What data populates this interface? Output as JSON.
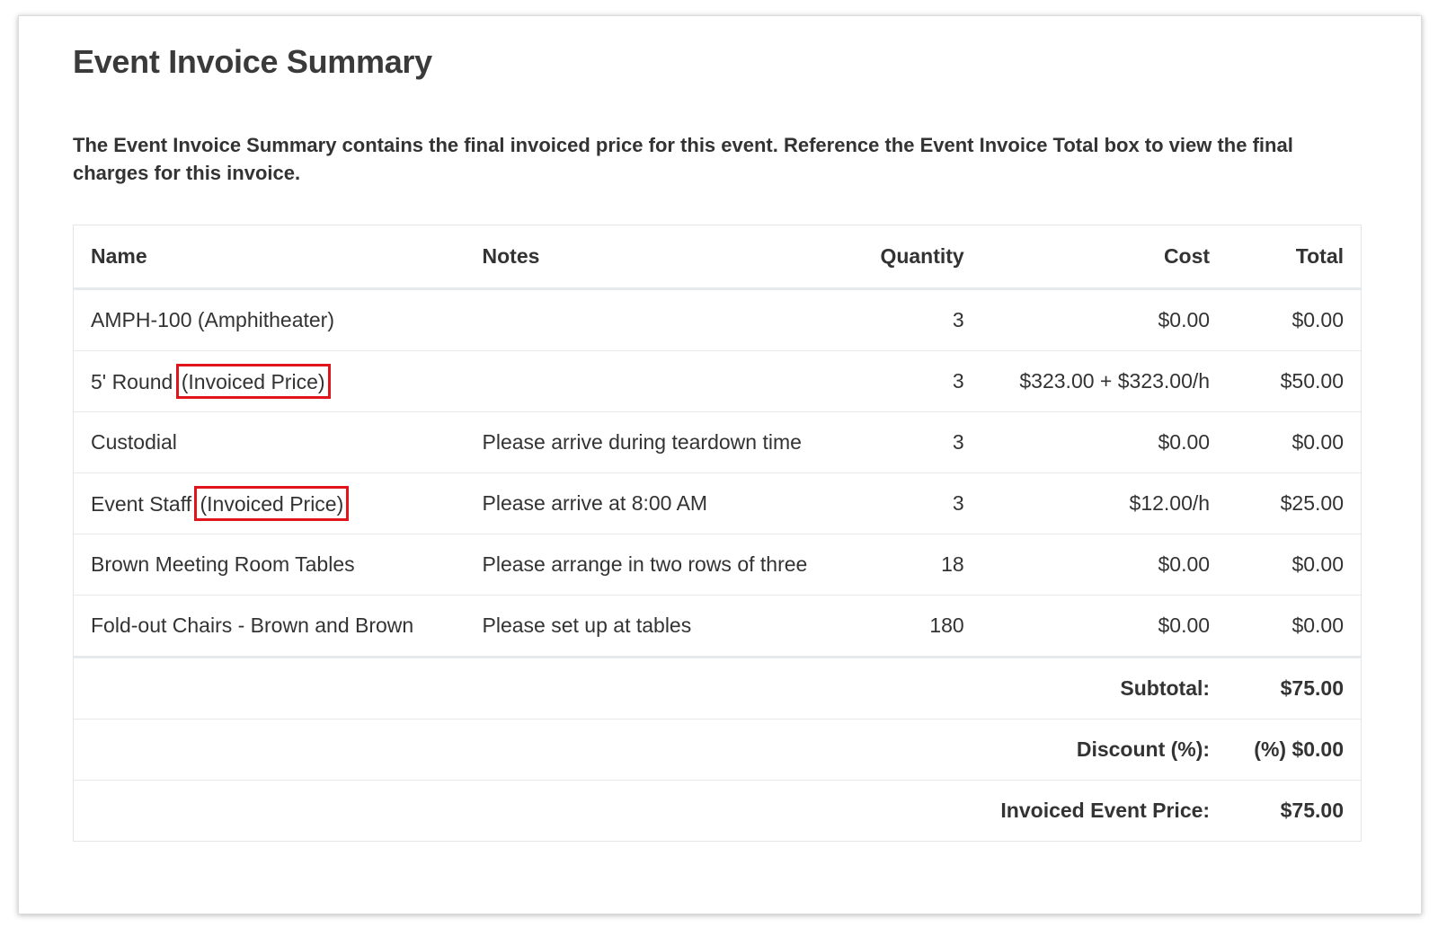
{
  "page": {
    "title": "Event Invoice Summary",
    "description": "The Event Invoice Summary contains the final invoiced price for this event. Reference the Event Invoice Total box to view the final charges for this invoice."
  },
  "table": {
    "headers": {
      "name": "Name",
      "notes": "Notes",
      "quantity": "Quantity",
      "cost": "Cost",
      "total": "Total"
    },
    "rows": [
      {
        "name": "AMPH-100 (Amphitheater)",
        "tag": "",
        "notes": "",
        "quantity": "3",
        "cost": "$0.00",
        "total": "$0.00"
      },
      {
        "name": "5' Round",
        "tag": "(Invoiced Price)",
        "notes": "",
        "quantity": "3",
        "cost": "$323.00 + $323.00/h",
        "total": "$50.00"
      },
      {
        "name": "Custodial",
        "tag": "",
        "notes": "Please arrive during teardown time",
        "quantity": "3",
        "cost": "$0.00",
        "total": "$0.00"
      },
      {
        "name": "Event Staff",
        "tag": "(Invoiced Price)",
        "notes": "Please arrive at 8:00 AM",
        "quantity": "3",
        "cost": "$12.00/h",
        "total": "$25.00"
      },
      {
        "name": "Brown Meeting Room Tables",
        "tag": "",
        "notes": "Please arrange in two rows of three",
        "quantity": "18",
        "cost": "$0.00",
        "total": "$0.00"
      },
      {
        "name": "Fold-out Chairs - Brown and Brown",
        "tag": "",
        "notes": "Please set up at tables",
        "quantity": "180",
        "cost": "$0.00",
        "total": "$0.00"
      }
    ],
    "summary": [
      {
        "label": "Subtotal:",
        "value": "$75.00"
      },
      {
        "label": "Discount (%):",
        "value": "(%) $0.00"
      },
      {
        "label": "Invoiced Event Price:",
        "value": "$75.00"
      }
    ]
  },
  "colors": {
    "highlight_border": "#e0151b",
    "text": "#333333",
    "row_border": "#e7eaec"
  }
}
